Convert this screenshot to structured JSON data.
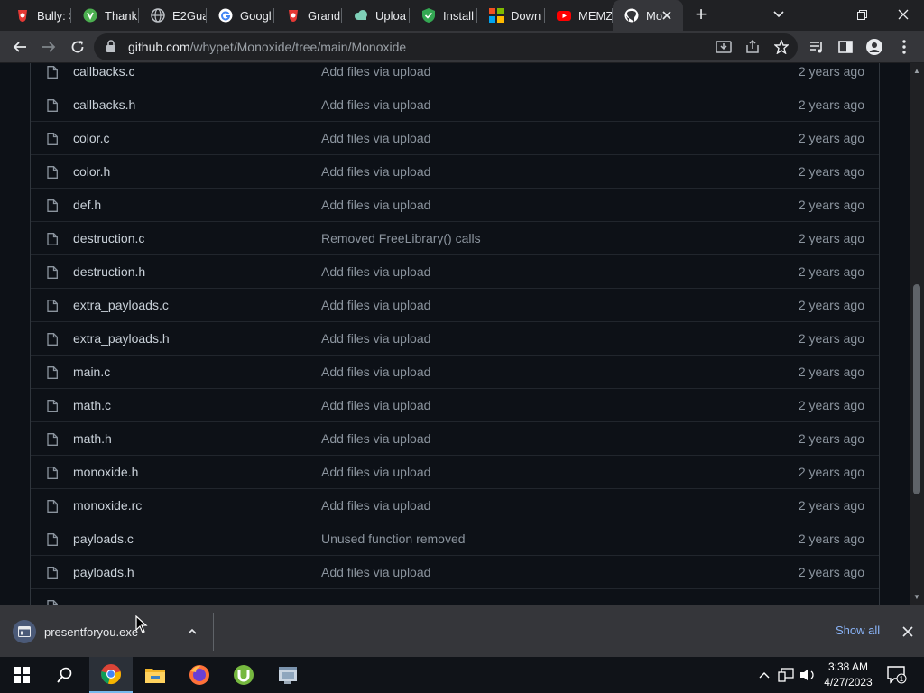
{
  "browser": {
    "tabs": [
      {
        "label": "Bully: S",
        "icon": "red-logo-icon",
        "color": "#e53935"
      },
      {
        "label": "Thank",
        "icon": "green-logo-icon",
        "color": "#4caf50"
      },
      {
        "label": "E2Gua",
        "icon": "globe-icon",
        "color": "#bdc1c6"
      },
      {
        "label": "Googl",
        "icon": "google-icon",
        "color": "#ffffff"
      },
      {
        "label": "Grand",
        "icon": "red-logo-icon",
        "color": "#e53935"
      },
      {
        "label": "Uploa",
        "icon": "cloud-icon",
        "color": "#7fd0b8"
      },
      {
        "label": "Install",
        "icon": "shield-check-icon",
        "color": "#34a853"
      },
      {
        "label": "Down",
        "icon": "windows-logo-icon",
        "color": "#f25022"
      },
      {
        "label": "MEMZ",
        "icon": "youtube-icon",
        "color": "#ff0000"
      },
      {
        "label": "Mo",
        "icon": "github-icon",
        "color": "#ffffff",
        "active": true
      }
    ],
    "url_host": "github.com",
    "url_path": "/whypet/Monoxide/tree/main/Monoxide"
  },
  "files": [
    {
      "name": "callbacks.c",
      "message": "Add files via upload",
      "age": "2 years ago"
    },
    {
      "name": "callbacks.h",
      "message": "Add files via upload",
      "age": "2 years ago"
    },
    {
      "name": "color.c",
      "message": "Add files via upload",
      "age": "2 years ago"
    },
    {
      "name": "color.h",
      "message": "Add files via upload",
      "age": "2 years ago"
    },
    {
      "name": "def.h",
      "message": "Add files via upload",
      "age": "2 years ago"
    },
    {
      "name": "destruction.c",
      "message": "Removed FreeLibrary() calls",
      "age": "2 years ago"
    },
    {
      "name": "destruction.h",
      "message": "Add files via upload",
      "age": "2 years ago"
    },
    {
      "name": "extra_payloads.c",
      "message": "Add files via upload",
      "age": "2 years ago"
    },
    {
      "name": "extra_payloads.h",
      "message": "Add files via upload",
      "age": "2 years ago"
    },
    {
      "name": "main.c",
      "message": "Add files via upload",
      "age": "2 years ago"
    },
    {
      "name": "math.c",
      "message": "Add files via upload",
      "age": "2 years ago"
    },
    {
      "name": "math.h",
      "message": "Add files via upload",
      "age": "2 years ago"
    },
    {
      "name": "monoxide.h",
      "message": "Add files via upload",
      "age": "2 years ago"
    },
    {
      "name": "monoxide.rc",
      "message": "Add files via upload",
      "age": "2 years ago"
    },
    {
      "name": "payloads.c",
      "message": "Unused function removed",
      "age": "2 years ago"
    },
    {
      "name": "payloads.h",
      "message": "Add files via upload",
      "age": "2 years ago"
    },
    {
      "name": "",
      "message": "",
      "age": ""
    }
  ],
  "download_bar": {
    "filename": "presentforyou.exe",
    "show_all": "Show all"
  },
  "taskbar": {
    "apps": [
      "chrome-icon",
      "file-explorer-icon",
      "firefox-icon",
      "utorrent-icon",
      "app-window-icon"
    ],
    "time": "3:38 AM",
    "date": "4/27/2023",
    "notification_count": "1"
  }
}
